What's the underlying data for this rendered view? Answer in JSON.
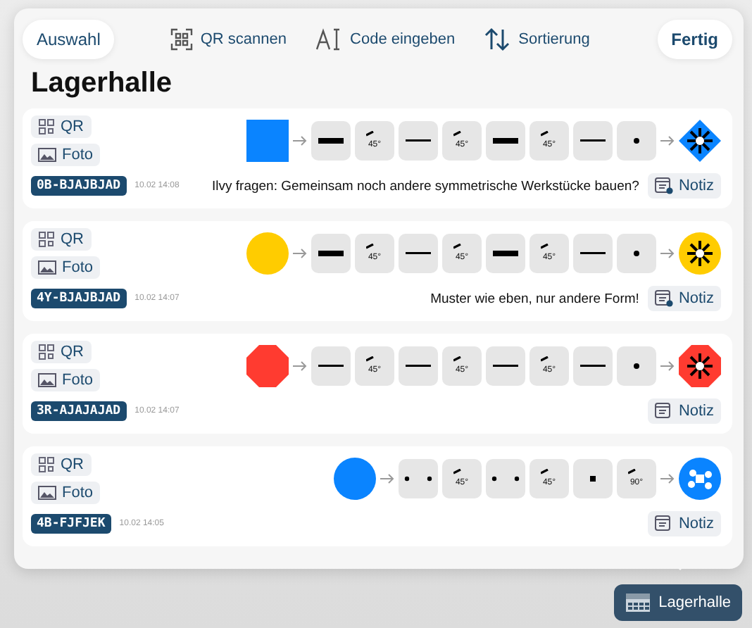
{
  "toolbar": {
    "left_button": "Auswahl",
    "actions": [
      {
        "kind": "qr",
        "label": "QR scannen"
      },
      {
        "kind": "text",
        "label": "Code eingeben"
      },
      {
        "kind": "sort",
        "label": "Sortierung"
      }
    ],
    "right_button": "Fertig"
  },
  "title": "Lagerhalle",
  "items": [
    {
      "qr": "QR",
      "photo": "Foto",
      "start": {
        "kind": "square",
        "color": "#0a84ff"
      },
      "steps": [
        {
          "kind": "thick"
        },
        {
          "kind": "angle",
          "label": "45°"
        },
        {
          "kind": "thin"
        },
        {
          "kind": "angle",
          "label": "45°"
        },
        {
          "kind": "thick"
        },
        {
          "kind": "angle",
          "label": "45°"
        },
        {
          "kind": "thin"
        },
        {
          "kind": "dot"
        }
      ],
      "end": {
        "kind": "diamond",
        "color": "#0a84ff",
        "inner": {
          "kind": "star"
        }
      },
      "code": "0B-BJAJBJAD",
      "time": "10.02 14:08",
      "note": "Ilvy fragen: Gemeinsam noch andere symmetrische Werkstücke bauen?",
      "has_note": true,
      "note_button": "Notiz"
    },
    {
      "qr": "QR",
      "photo": "Foto",
      "start": {
        "kind": "circle",
        "color": "#ffcc00"
      },
      "steps": [
        {
          "kind": "thick"
        },
        {
          "kind": "angle",
          "label": "45°"
        },
        {
          "kind": "thin"
        },
        {
          "kind": "angle",
          "label": "45°"
        },
        {
          "kind": "thick"
        },
        {
          "kind": "angle",
          "label": "45°"
        },
        {
          "kind": "thin"
        },
        {
          "kind": "dot"
        }
      ],
      "end": {
        "kind": "circle",
        "color": "#ffcc00",
        "inner": {
          "kind": "star"
        }
      },
      "code": "4Y-BJAJBJAD",
      "time": "10.02 14:07",
      "note": "Muster wie eben, nur andere Form!",
      "has_note": true,
      "note_button": "Notiz"
    },
    {
      "qr": "QR",
      "photo": "Foto",
      "start": {
        "kind": "octagon",
        "color": "#ff3b30"
      },
      "steps": [
        {
          "kind": "thin"
        },
        {
          "kind": "angle",
          "label": "45°"
        },
        {
          "kind": "thin"
        },
        {
          "kind": "angle",
          "label": "45°"
        },
        {
          "kind": "thin"
        },
        {
          "kind": "angle",
          "label": "45°"
        },
        {
          "kind": "thin"
        },
        {
          "kind": "dot"
        }
      ],
      "end": {
        "kind": "octagon",
        "color": "#ff3b30",
        "inner": {
          "kind": "star"
        }
      },
      "code": "3R-AJAJAJAD",
      "time": "10.02 14:07",
      "has_note": false,
      "note_button": "Notiz"
    },
    {
      "qr": "QR",
      "photo": "Foto",
      "start": {
        "kind": "circle",
        "color": "#0a84ff"
      },
      "steps": [
        {
          "kind": "dots"
        },
        {
          "kind": "angle",
          "label": "45°"
        },
        {
          "kind": "dots"
        },
        {
          "kind": "angle",
          "label": "45°"
        },
        {
          "kind": "square"
        },
        {
          "kind": "angle",
          "label": "90°"
        }
      ],
      "end": {
        "kind": "circle",
        "color": "#0a84ff",
        "inner": {
          "kind": "cluster"
        }
      },
      "code": "4B-FJFJEK",
      "time": "10.02 14:05",
      "has_note": false,
      "note_button": "Notiz"
    }
  ],
  "footer_button": "Lagerhalle"
}
